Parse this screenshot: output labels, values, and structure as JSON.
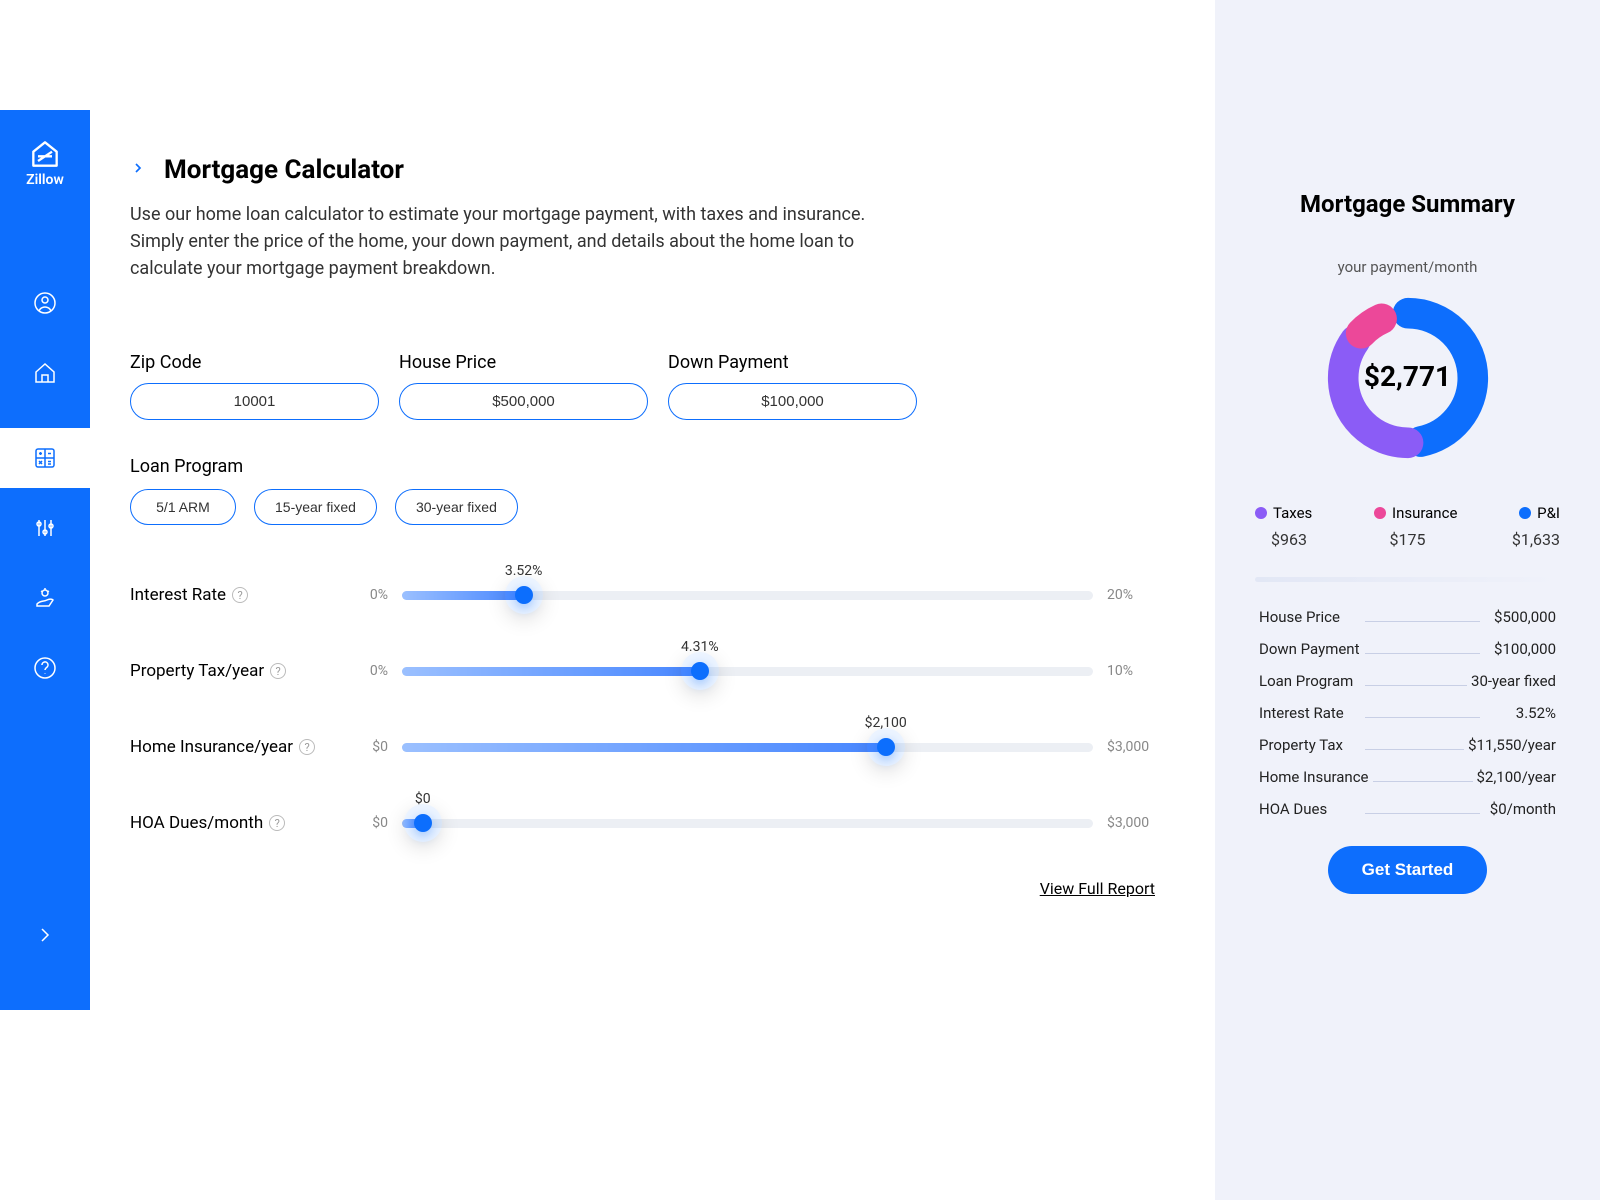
{
  "brand": "Zillow",
  "page": {
    "title": "Mortgage Calculator",
    "description": "Use our home loan calculator to estimate your mortgage payment, with taxes and insurance. Simply enter the price of the home, your down payment, and details about the home loan to calculate your mortgage payment breakdown."
  },
  "inputs": {
    "zip_label": "Zip Code",
    "zip_value": "10001",
    "price_label": "House Price",
    "price_value": "$500,000",
    "down_label": "Down Payment",
    "down_value": "$100,000"
  },
  "loan_program": {
    "label": "Loan Program",
    "options": [
      "5/1 ARM",
      "15-year fixed",
      "30-year fixed"
    ]
  },
  "sliders": {
    "interest": {
      "label": "Interest Rate",
      "min": "0%",
      "max": "20%",
      "value": "3.52%",
      "pct": 17.6
    },
    "tax": {
      "label": "Property Tax/year",
      "min": "0%",
      "max": "10%",
      "value": "4.31%",
      "pct": 43.1
    },
    "insurance": {
      "label": "Home Insurance/year",
      "min": "$0",
      "max": "$3,000",
      "value": "$2,100",
      "pct": 70
    },
    "hoa": {
      "label": "HOA Dues/month",
      "min": "$0",
      "max": "$3,000",
      "value": "$0",
      "pct": 3
    }
  },
  "view_report": "View Full Report",
  "summary": {
    "title": "Mortgage Summary",
    "subtitle": "your payment/month",
    "total": "$2,771",
    "legend": {
      "taxes_label": "Taxes",
      "taxes_value": "$963",
      "insurance_label": "Insurance",
      "insurance_value": "$175",
      "pi_label": "P&I",
      "pi_value": "$1,633"
    },
    "details": [
      {
        "k": "House Price",
        "v": "$500,000"
      },
      {
        "k": "Down Payment",
        "v": "$100,000"
      },
      {
        "k": "Loan Program",
        "v": "30-year fixed"
      },
      {
        "k": "Interest Rate",
        "v": "3.52%"
      },
      {
        "k": "Property Tax",
        "v": "$11,550/year"
      },
      {
        "k": "Home Insurance",
        "v": "$2,100/year"
      },
      {
        "k": "HOA Dues",
        "v": "$0/month"
      }
    ],
    "cta": "Get Started"
  },
  "colors": {
    "blue": "#0d6efd",
    "purple": "#8b5cf6",
    "pink": "#ec4899"
  }
}
